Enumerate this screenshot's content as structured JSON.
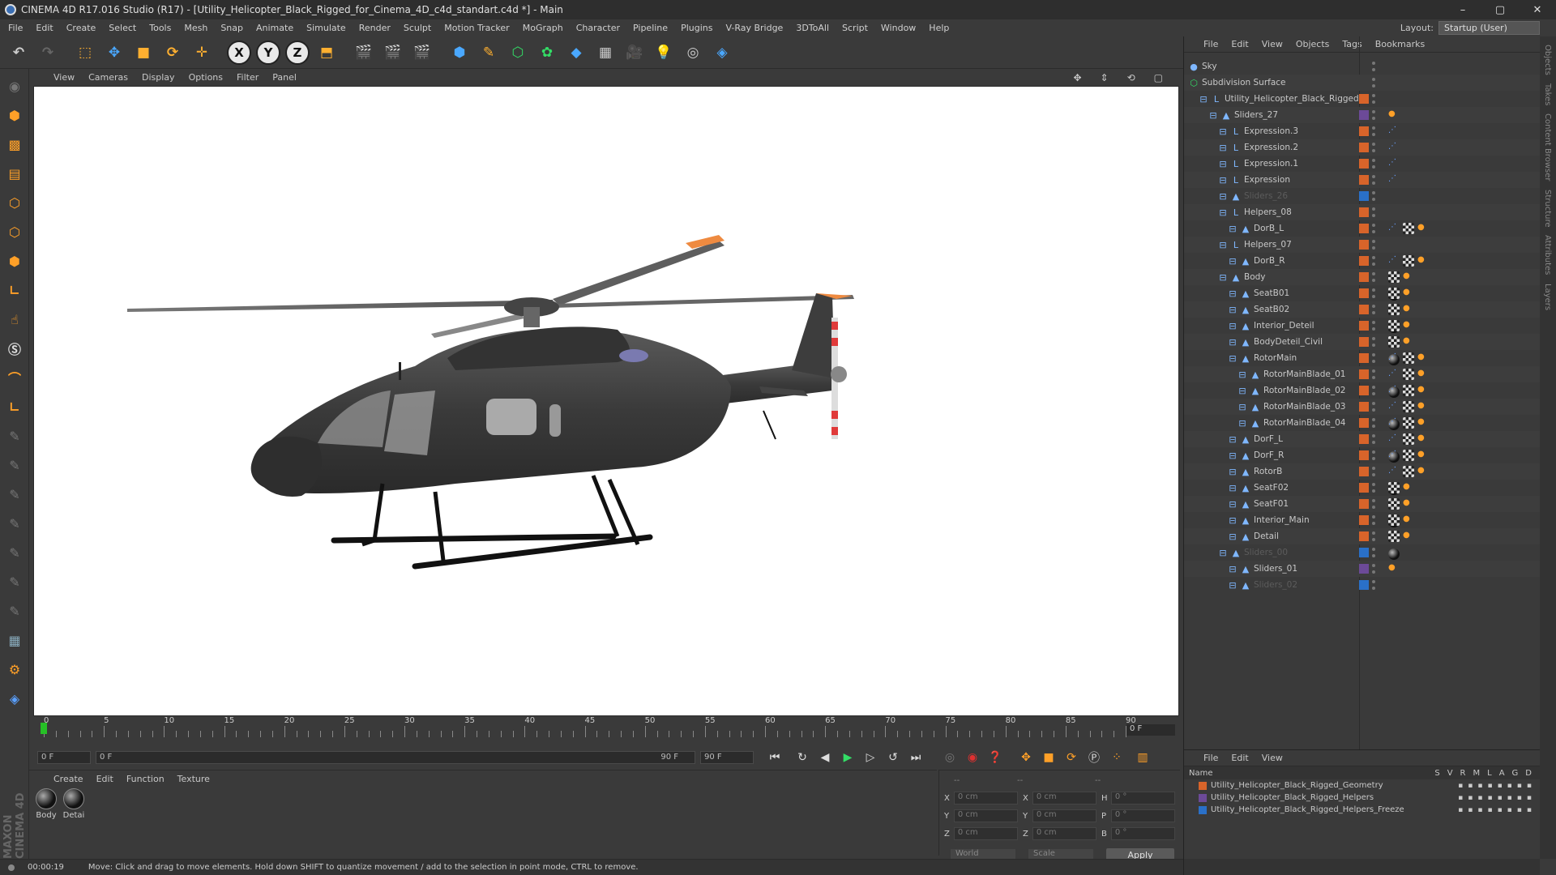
{
  "window": {
    "title": "CINEMA 4D R17.016 Studio (R17) - [Utility_Helicopter_Black_Rigged_for_Cinema_4D_c4d_standart.c4d *] - Main",
    "buttons": [
      "–",
      "▢",
      "✕"
    ]
  },
  "menubar": [
    "File",
    "Edit",
    "Create",
    "Select",
    "Tools",
    "Mesh",
    "Snap",
    "Animate",
    "Simulate",
    "Render",
    "Sculpt",
    "Motion Tracker",
    "MoGraph",
    "Character",
    "Pipeline",
    "Plugins",
    "V-Ray Bridge",
    "3DToAll",
    "Script",
    "Window",
    "Help"
  ],
  "layout": {
    "label": "Layout:",
    "value": "Startup (User)"
  },
  "viewport": {
    "menu": [
      "View",
      "Cameras",
      "Display",
      "Options",
      "Filter",
      "Panel"
    ],
    "nav_icons": [
      "✥",
      "⇕",
      "⟲",
      "▢"
    ]
  },
  "timeline": {
    "ticks": [
      "0",
      "5",
      "10",
      "15",
      "20",
      "25",
      "30",
      "35",
      "40",
      "45",
      "50",
      "55",
      "60",
      "65",
      "70",
      "75",
      "80",
      "85",
      "90"
    ],
    "current_frame": "0 F",
    "start_field": "0 F",
    "range_start": "0 F",
    "range_end": "90 F",
    "end_field": "90 F"
  },
  "materials": {
    "menu": [
      "Create",
      "Edit",
      "Function",
      "Texture"
    ],
    "items": [
      {
        "name": "Body"
      },
      {
        "name": "Detai"
      }
    ]
  },
  "coords": {
    "header": [
      "--",
      "--",
      "--"
    ],
    "rows": [
      {
        "a": "X",
        "av": "0 cm",
        "b": "X",
        "bv": "0 cm",
        "c": "H",
        "cv": "0 °"
      },
      {
        "a": "Y",
        "av": "0 cm",
        "b": "Y",
        "bv": "0 cm",
        "c": "P",
        "cv": "0 °"
      },
      {
        "a": "Z",
        "av": "0 cm",
        "b": "Z",
        "bv": "0 cm",
        "c": "B",
        "cv": "0 °"
      }
    ],
    "world": "World",
    "scale": "Scale",
    "apply": "Apply"
  },
  "maxon": "MAXON CINEMA 4D",
  "status": {
    "time": "00:00:19",
    "message": "Move: Click and drag to move elements. Hold down SHIFT to quantize movement / add to the selection in point mode, CTRL to remove."
  },
  "objects": {
    "menu": [
      "File",
      "Edit",
      "View",
      "Objects",
      "Tags",
      "Bookmarks"
    ],
    "rows": [
      {
        "name": "Sky",
        "depth": 0,
        "layer": "none",
        "tags": []
      },
      {
        "name": "Subdivision Surface",
        "depth": 0,
        "layer": "none",
        "tags": []
      },
      {
        "name": "Utility_Helicopter_Black_Rigged",
        "depth": 1,
        "layer": "orange",
        "tags": []
      },
      {
        "name": "Sliders_27",
        "depth": 2,
        "layer": "purple",
        "tags": [
          "dot"
        ]
      },
      {
        "name": "Expression.3",
        "depth": 3,
        "layer": "orange",
        "tags": [
          "exp"
        ]
      },
      {
        "name": "Expression.2",
        "depth": 3,
        "layer": "orange",
        "tags": [
          "exp"
        ]
      },
      {
        "name": "Expression.1",
        "depth": 3,
        "layer": "orange",
        "tags": [
          "exp"
        ]
      },
      {
        "name": "Expression",
        "depth": 3,
        "layer": "orange",
        "tags": [
          "exp"
        ]
      },
      {
        "name": "Sliders_26",
        "depth": 3,
        "layer": "blue",
        "tags": [],
        "faded": true
      },
      {
        "name": "Helpers_08",
        "depth": 3,
        "layer": "orange",
        "tags": []
      },
      {
        "name": "DorB_L",
        "depth": 4,
        "layer": "orange",
        "tags": [
          "exp",
          "mat",
          "chk",
          "dot"
        ]
      },
      {
        "name": "Helpers_07",
        "depth": 3,
        "layer": "orange",
        "tags": []
      },
      {
        "name": "DorB_R",
        "depth": 4,
        "layer": "orange",
        "tags": [
          "exp",
          "mat",
          "chk",
          "dot"
        ]
      },
      {
        "name": "Body",
        "depth": 3,
        "layer": "orange",
        "tags": [
          "mat",
          "chk",
          "dot"
        ]
      },
      {
        "name": "SeatB01",
        "depth": 4,
        "layer": "orange",
        "tags": [
          "mat",
          "chk",
          "dot"
        ]
      },
      {
        "name": "SeatB02",
        "depth": 4,
        "layer": "orange",
        "tags": [
          "mat",
          "chk",
          "dot"
        ]
      },
      {
        "name": "Interior_Deteil",
        "depth": 4,
        "layer": "orange",
        "tags": [
          "mat",
          "chk",
          "dot"
        ]
      },
      {
        "name": "BodyDeteil_Civil",
        "depth": 4,
        "layer": "orange",
        "tags": [
          "mat",
          "chk",
          "dot"
        ]
      },
      {
        "name": "RotorMain",
        "depth": 4,
        "layer": "orange",
        "tags": [
          "exp",
          "mat",
          "chk",
          "dot"
        ]
      },
      {
        "name": "RotorMainBlade_01",
        "depth": 5,
        "layer": "orange",
        "tags": [
          "exp",
          "mat",
          "chk",
          "dot"
        ]
      },
      {
        "name": "RotorMainBlade_02",
        "depth": 5,
        "layer": "orange",
        "tags": [
          "exp",
          "mat",
          "chk",
          "dot"
        ]
      },
      {
        "name": "RotorMainBlade_03",
        "depth": 5,
        "layer": "orange",
        "tags": [
          "exp",
          "mat",
          "chk",
          "dot"
        ]
      },
      {
        "name": "RotorMainBlade_04",
        "depth": 5,
        "layer": "orange",
        "tags": [
          "exp",
          "mat",
          "chk",
          "dot"
        ]
      },
      {
        "name": "DorF_L",
        "depth": 4,
        "layer": "orange",
        "tags": [
          "exp",
          "mat",
          "chk",
          "dot"
        ]
      },
      {
        "name": "DorF_R",
        "depth": 4,
        "layer": "orange",
        "tags": [
          "exp",
          "mat",
          "chk",
          "dot"
        ]
      },
      {
        "name": "RotorB",
        "depth": 4,
        "layer": "orange",
        "tags": [
          "exp",
          "mat",
          "chk",
          "dot"
        ]
      },
      {
        "name": "SeatF02",
        "depth": 4,
        "layer": "orange",
        "tags": [
          "mat",
          "chk",
          "dot"
        ]
      },
      {
        "name": "SeatF01",
        "depth": 4,
        "layer": "orange",
        "tags": [
          "mat",
          "chk",
          "dot"
        ]
      },
      {
        "name": "Interior_Main",
        "depth": 4,
        "layer": "orange",
        "tags": [
          "mat",
          "chk",
          "dot"
        ]
      },
      {
        "name": "Detail",
        "depth": 4,
        "layer": "orange",
        "tags": [
          "mat",
          "chk",
          "dot"
        ]
      },
      {
        "name": "Sliders_00",
        "depth": 3,
        "layer": "blue",
        "tags": [],
        "faded": true
      },
      {
        "name": "Sliders_01",
        "depth": 4,
        "layer": "purple",
        "tags": [
          "dot"
        ]
      },
      {
        "name": "Sliders_02",
        "depth": 4,
        "layer": "blue",
        "tags": [],
        "faded": true
      }
    ]
  },
  "side_tabs": [
    "Objects",
    "Takes",
    "Content Browser",
    "Structure",
    "Attributes",
    "Layers"
  ],
  "layers": {
    "menu": [
      "File",
      "Edit",
      "View"
    ],
    "header_name": "Name",
    "header_cols": [
      "S",
      "V",
      "R",
      "M",
      "L",
      "A",
      "G",
      "D"
    ],
    "rows": [
      {
        "name": "Utility_Helicopter_Black_Rigged_Geometry",
        "color": "#d8642a"
      },
      {
        "name": "Utility_Helicopter_Black_Rigged_Helpers",
        "color": "#6c4a98"
      },
      {
        "name": "Utility_Helicopter_Black_Rigged_Helpers_Freeze",
        "color": "#2a70c8"
      }
    ]
  },
  "colors": {
    "accent": "#ffa028",
    "playhead": "#26c026",
    "viewport_bg": "#ffffff"
  }
}
